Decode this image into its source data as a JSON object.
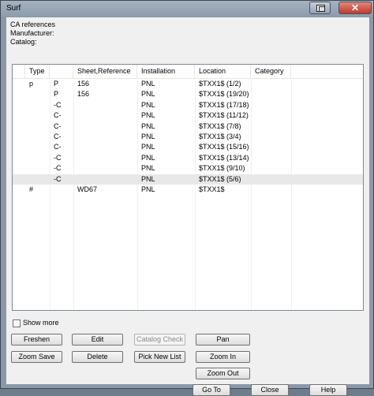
{
  "window": {
    "title": "Surf"
  },
  "info": {
    "line1": "CA references",
    "line2": "Manufacturer:",
    "line3": "Catalog:"
  },
  "table": {
    "columns": [
      "",
      "Type",
      "",
      "Sheet,Reference",
      "Installation",
      "Location",
      "Category"
    ],
    "rows": [
      [
        "p",
        "P",
        "156",
        "PNL",
        "$TXX1$ (1/2)",
        ""
      ],
      [
        "",
        "P",
        "156",
        "PNL",
        "$TXX1$ (19/20)",
        ""
      ],
      [
        "",
        "-C",
        "",
        "PNL",
        "$TXX1$ (17/18)",
        ""
      ],
      [
        "",
        "C-",
        "",
        "PNL",
        "$TXX1$ (11/12)",
        ""
      ],
      [
        "",
        "C-",
        "",
        "PNL",
        "$TXX1$ (7/8)",
        ""
      ],
      [
        "",
        "C-",
        "",
        "PNL",
        "$TXX1$ (3/4)",
        ""
      ],
      [
        "",
        "C-",
        "",
        "PNL",
        "$TXX1$ (15/16)",
        ""
      ],
      [
        "",
        "-C",
        "",
        "PNL",
        "$TXX1$ (13/14)",
        ""
      ],
      [
        "",
        "-C",
        "",
        "PNL",
        "$TXX1$ (9/10)",
        ""
      ],
      [
        "",
        "-C",
        "",
        "PNL",
        "$TXX1$ (5/6)",
        ""
      ],
      [
        "#",
        "",
        "WD67",
        "PNL",
        "$TXX1$",
        ""
      ]
    ]
  },
  "show_more": {
    "label": "Show more",
    "checked": false
  },
  "buttons": {
    "freshen": "Freshen",
    "edit": "Edit",
    "catalog_check": "Catalog Check",
    "pan": "Pan",
    "zoom_save": "Zoom Save",
    "delete": "Delete",
    "pick_new_list": "Pick New List",
    "zoom_in": "Zoom In",
    "zoom_out": "Zoom Out",
    "go_to": "Go To",
    "close": "Close",
    "help": "Help"
  }
}
